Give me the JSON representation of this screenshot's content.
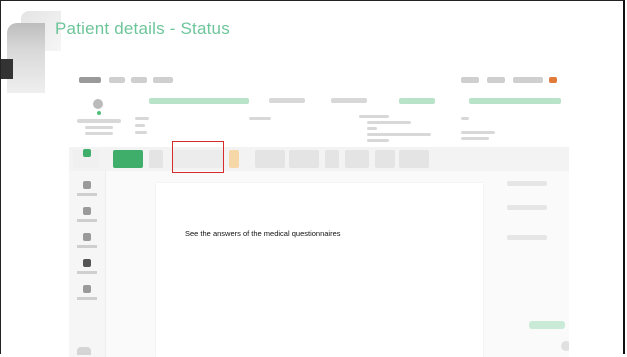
{
  "slide": {
    "title": "Patient details - Status"
  },
  "document": {
    "caption": "See the answers of the medical questionnaires"
  },
  "colors": {
    "title": "#6dc59a",
    "highlight": "#d62b2b",
    "accent_green": "#3fae6a"
  }
}
